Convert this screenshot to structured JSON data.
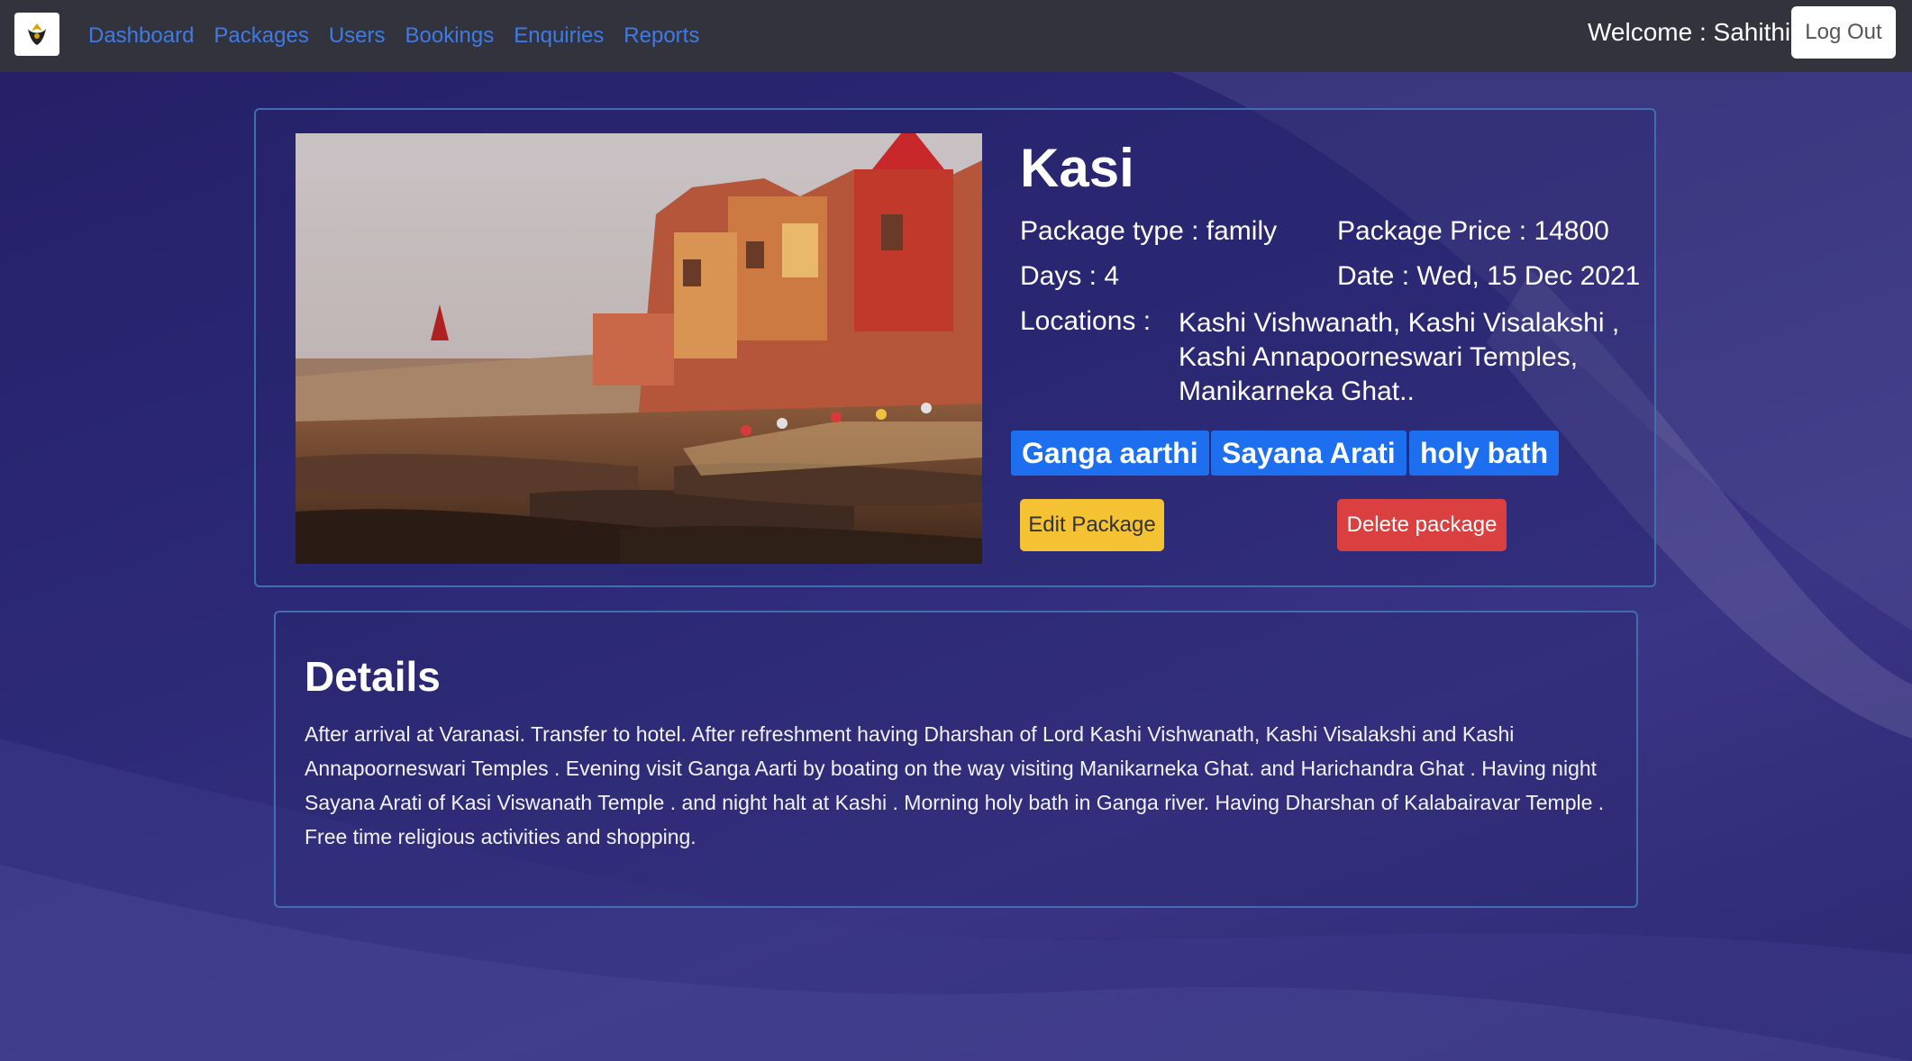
{
  "navbar": {
    "links": [
      "Dashboard",
      "Packages",
      "Users",
      "Bookings",
      "Enquiries",
      "Reports"
    ],
    "welcome": "Welcome : Sahithi |",
    "logout_label": "Log Out"
  },
  "package": {
    "title": "Kasi",
    "type_label": "Package type : family",
    "price_label": "Package Price : 14800",
    "days_label": "Days : 4",
    "date_label": "Date : Wed, 15 Dec 2021",
    "locations_label": "Locations :",
    "locations_value": "Kashi Vishwanath, Kashi Visalakshi , Kashi Annapoorneswari Temples, Manikarneka Ghat..",
    "tags": [
      "Ganga aarthi",
      "Sayana Arati",
      "holy bath"
    ],
    "edit_label": "Edit Package",
    "delete_label": "Delete package"
  },
  "details": {
    "heading": "Details",
    "text": "After arrival at Varanasi. Transfer to hotel. After refreshment having Dharshan of Lord Kashi Vishwanath, Kashi Visalakshi and Kashi Annapoorneswari Temples . Evening visit Ganga Aarti by boating on the way visiting Manikarneka Ghat. and Harichandra Ghat . Having night Sayana Arati of Kasi Viswanath Temple . and night halt at Kashi . Morning holy bath in Ganga river. Having Dharshan of Kalabairavar Temple . Free time religious activities and shopping."
  },
  "colors": {
    "nav_bg": "#33333d",
    "link": "#3d7be6",
    "tag": "#1e6ff0",
    "edit": "#f5c233",
    "delete": "#d9403f",
    "page_bg": "#2a2670"
  }
}
